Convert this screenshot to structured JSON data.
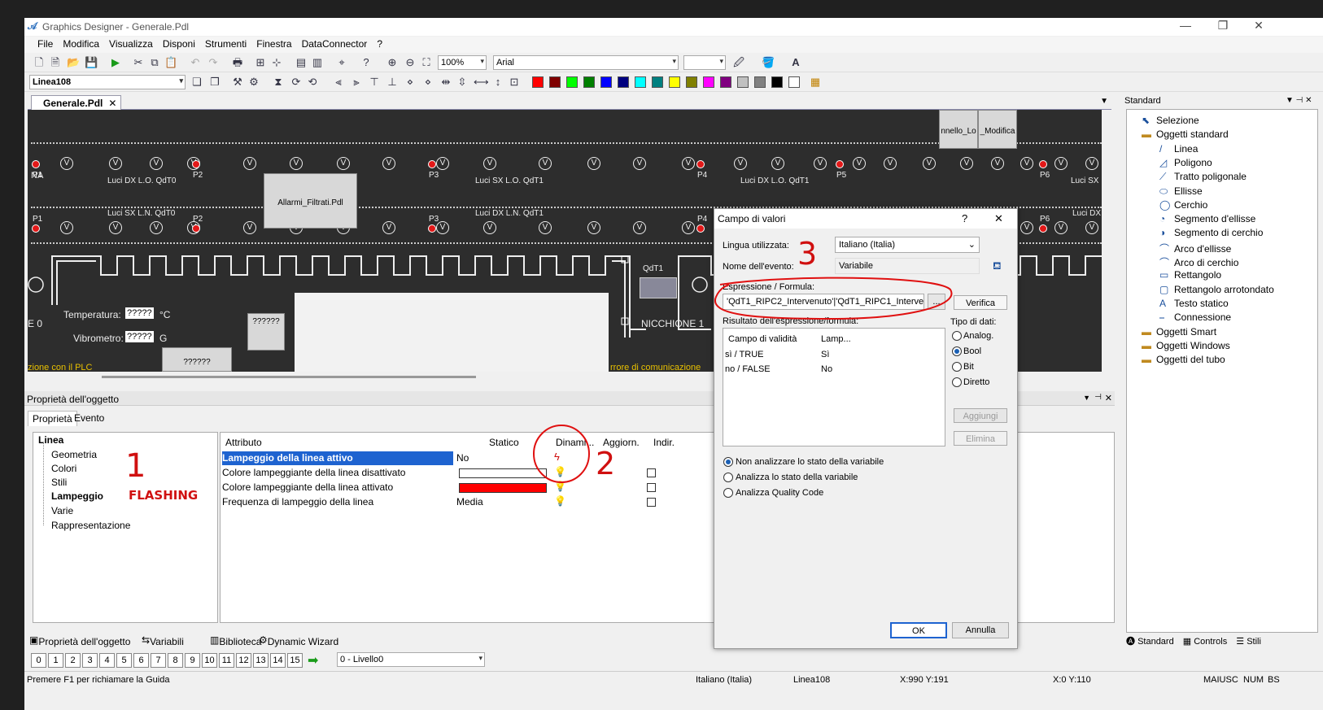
{
  "window": {
    "title": "Graphics Designer - Generale.Pdl"
  },
  "menu": [
    "File",
    "Modifica",
    "Visualizza",
    "Disponi",
    "Strumenti",
    "Finestra",
    "DataConnector",
    "?"
  ],
  "toolbar": {
    "zoom": "100%",
    "font": "Arial",
    "object_selector": "Linea108"
  },
  "colors": [
    "#ff0000",
    "#800000",
    "#00ff00",
    "#008000",
    "#0000ff",
    "#000080",
    "#00ffff",
    "#008080",
    "#ffff00",
    "#808000",
    "#ff00ff",
    "#800080",
    "#c0c0c0",
    "#808080",
    "#000000",
    "#ffffff"
  ],
  "doc_tab": {
    "label": "Generale.Pdl",
    "close": "✕"
  },
  "canvas": {
    "labels_top": [
      "P1",
      "P2",
      "P3",
      "P4",
      "P5",
      "P6"
    ],
    "labels_row2": [
      "P1",
      "P2",
      "P3",
      "P4",
      "P6"
    ],
    "text_luci1": "Luci DX L.O. QdT0",
    "text_luci2": "Luci SX L.O. QdT1",
    "text_luci3": "Luci DX L.O. QdT1",
    "text_luci4": "Luci SX",
    "text_luci5": "Luci SX L.N. QdT0",
    "text_luci6": "Luci DX L.N. QdT1",
    "text_luci7": "Luci DX",
    "na": "NA",
    "allarmi": "Allarmi_Filtrati.Pdl",
    "pannello1": "nnello_Lo",
    "pannello2": "_Modifica",
    "temperatura": "Temperatura:",
    "temp_val": "?????",
    "temp_unit": "°C",
    "vibrometro": "Vibrometro:",
    "vibro_val": "?????",
    "vibro_unit": "G",
    "q1": "??????",
    "q2": "??????",
    "e0": "E 0",
    "qdt1": "QdT1",
    "nicchione": "NICCHIONE 1",
    "yellow1": "zione con il PLC",
    "yellow2": "rrore di comunicazione"
  },
  "props": {
    "title": "Proprietà dell'oggetto",
    "tab1": "Proprietà",
    "tab2": "Evento",
    "tree": [
      "Linea",
      "Geometria",
      "Colori",
      "Stili",
      "Lampeggio",
      "Varie",
      "Rappresentazione"
    ],
    "headers": [
      "Attributo",
      "Statico",
      "Dinami...",
      "Aggiorn.",
      "Indir."
    ],
    "rows": [
      {
        "attr": "Lampeggio della linea attivo",
        "static": "No"
      },
      {
        "attr": "Colore lampeggiante della linea disattivato",
        "static": ""
      },
      {
        "attr": "Colore lampeggiante della linea attivato",
        "static": ""
      },
      {
        "attr": "Frequenza di lampeggio della linea",
        "static": "Media"
      }
    ],
    "flash_color_off": "#ffffff",
    "flash_color_on": "#ff0000"
  },
  "annotations": {
    "a1": "1",
    "a2": "2",
    "a3": "3",
    "flashing": "FLASHING"
  },
  "bottom_tabs": [
    "Proprietà dell'oggetto",
    "Variabili",
    "Biblioteca",
    "Dynamic Wizard"
  ],
  "layers": [
    "0",
    "1",
    "2",
    "3",
    "4",
    "5",
    "6",
    "7",
    "8",
    "9",
    "10",
    "11",
    "12",
    "13",
    "14",
    "15"
  ],
  "layer_select": "0 - Livello0",
  "status": {
    "help": "Premere F1 per richiamare la Guida",
    "lang": "Italiano (Italia)",
    "obj": "Linea108",
    "pos": "X:990 Y:191",
    "size": "X:0 Y:110",
    "maiusc": "MAIUSC",
    "num": "NUM",
    "bs": "BS"
  },
  "rpanel": {
    "title": "Standard",
    "items": [
      "Selezione",
      "Oggetti standard",
      "Linea",
      "Poligono",
      "Tratto poligonale",
      "Ellisse",
      "Cerchio",
      "Segmento d'ellisse",
      "Segmento di cerchio",
      "Arco d'ellisse",
      "Arco di cerchio",
      "Rettangolo",
      "Rettangolo arrotondato",
      "Testo statico",
      "Connessione",
      "Oggetti Smart",
      "Oggetti Windows",
      "Oggetti del tubo"
    ],
    "tabs": [
      "Standard",
      "Controls",
      "Stili"
    ]
  },
  "dialog": {
    "title": "Campo di valori",
    "help": "?",
    "close": "✕",
    "lang_label": "Lingua utilizzata:",
    "lang_value": "Italiano (Italia)",
    "event_label": "Nome dell'evento:",
    "event_value": "Variabile",
    "expr_label": "Espressione / Formula:",
    "expr_value": "'QdT1_RIPC2_Intervenuto'|'QdT1_RIPC1_Interven",
    "dots": "...",
    "verify": "Verifica",
    "result_label": "Risultato dell'espressione/formula:",
    "result_headers": [
      "Campo di validità",
      "Lamp..."
    ],
    "result_rows": [
      [
        "sì / TRUE",
        "Sì"
      ],
      [
        "no / FALSE",
        "No"
      ]
    ],
    "type_label": "Tipo di dati:",
    "types": [
      "Analog.",
      "Bool",
      "Bit",
      "Diretto"
    ],
    "add": "Aggiungi",
    "remove": "Elimina",
    "options": [
      "Non analizzare lo stato della variabile",
      "Analizza lo stato della variabile",
      "Analizza Quality Code"
    ],
    "ok": "OK",
    "cancel": "Annulla"
  }
}
